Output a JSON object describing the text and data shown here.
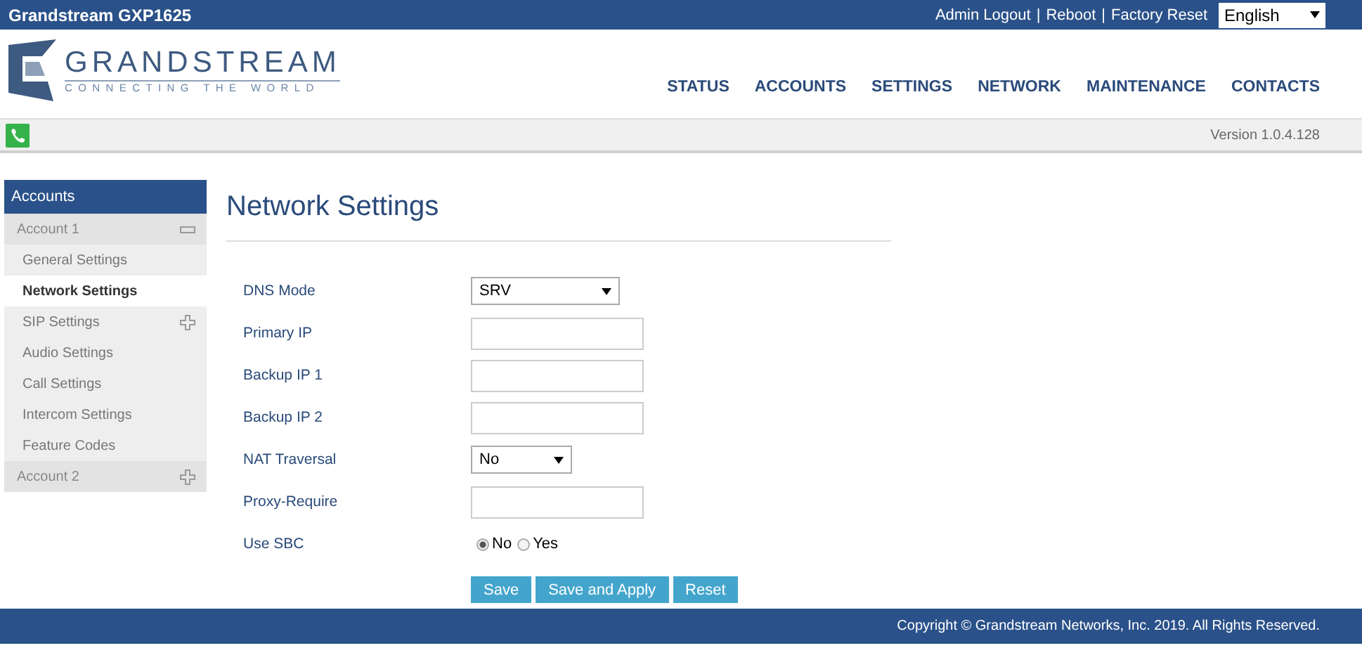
{
  "top_bar": {
    "title": "Grandstream GXP1625",
    "links": [
      "Admin Logout",
      "Reboot",
      "Factory Reset"
    ],
    "separators": [
      "|",
      "|"
    ],
    "language": "English"
  },
  "header": {
    "logo_name": "GRANDSTREAM",
    "logo_tagline": "CONNECTING THE WORLD",
    "nav": [
      "STATUS",
      "ACCOUNTS",
      "SETTINGS",
      "NETWORK",
      "MAINTENANCE",
      "CONTACTS"
    ]
  },
  "status_bar": {
    "version": "Version 1.0.4.128"
  },
  "sidebar": {
    "title": "Accounts",
    "items": [
      {
        "kind": "group",
        "label": "Account 1",
        "expanded": true,
        "children": [
          {
            "label": "General Settings",
            "selected": false
          },
          {
            "label": "Network Settings",
            "selected": true
          },
          {
            "label": "SIP Settings",
            "selected": false,
            "expandable": true
          },
          {
            "label": "Audio Settings",
            "selected": false
          },
          {
            "label": "Call Settings",
            "selected": false
          },
          {
            "label": "Intercom Settings",
            "selected": false
          },
          {
            "label": "Feature Codes",
            "selected": false
          }
        ]
      },
      {
        "kind": "group",
        "label": "Account 2",
        "expanded": false
      }
    ]
  },
  "page_title": "Network Settings",
  "fields": [
    {
      "kind": "select",
      "label": "DNS Mode",
      "value": "SRV"
    },
    {
      "kind": "text",
      "label": "Primary IP"
    },
    {
      "kind": "text",
      "label": "Backup IP 1"
    },
    {
      "kind": "text",
      "label": "Backup IP 2"
    },
    {
      "kind": "select",
      "label": "NAT Traversal",
      "value": "No"
    },
    {
      "kind": "text",
      "label": "Proxy-Require"
    },
    {
      "kind": "radio",
      "label": "Use SBC",
      "options": [
        {
          "label": "No",
          "selected": true
        },
        {
          "label": "Yes",
          "selected": false
        }
      ]
    }
  ],
  "buttons": [
    "Save",
    "Save and Apply",
    "Reset"
  ],
  "footer": "Copyright © Grandstream Networks, Inc. 2019. All Rights Reserved."
}
